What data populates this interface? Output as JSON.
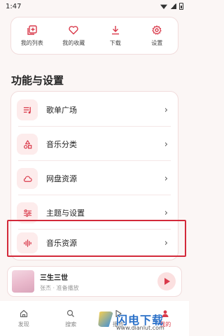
{
  "status": {
    "time": "1:47"
  },
  "quick_actions": [
    {
      "label": "我的列表",
      "icon": "playlist-add-icon"
    },
    {
      "label": "我的收藏",
      "icon": "heart-icon"
    },
    {
      "label": "下载",
      "icon": "download-icon"
    },
    {
      "label": "设置",
      "icon": "gear-icon"
    }
  ],
  "section": {
    "title": "功能与设置"
  },
  "settings": [
    {
      "label": "歌单广场",
      "icon": "playlist-icon"
    },
    {
      "label": "音乐分类",
      "icon": "shapes-icon"
    },
    {
      "label": "网盘资源",
      "icon": "cloud-icon"
    },
    {
      "label": "主题与设置",
      "icon": "sliders-icon"
    },
    {
      "label": "音乐资源",
      "icon": "waveform-icon"
    }
  ],
  "player": {
    "title": "三生三世",
    "subtitle": "张杰 · 准备播放"
  },
  "nav": [
    {
      "label": "发现",
      "icon": "home-icon",
      "active": false
    },
    {
      "label": "搜索",
      "icon": "search-icon",
      "active": false
    },
    {
      "label": "播放",
      "icon": "play-icon",
      "active": false
    },
    {
      "label": "我的",
      "icon": "person-icon",
      "active": true
    }
  ],
  "watermark": {
    "name": "闪电下载",
    "url": "www.dianlut.com"
  },
  "colors": {
    "accent": "#d9394a",
    "highlight": "#d3293a",
    "background": "#fbf6f5"
  }
}
